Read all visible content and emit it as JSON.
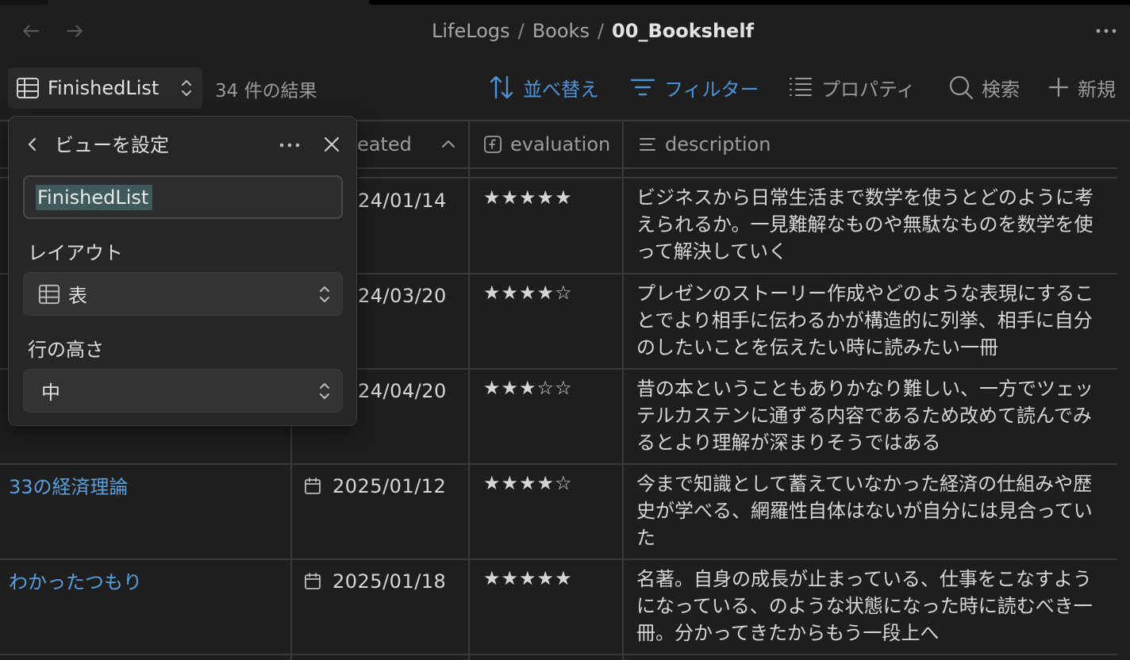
{
  "titlebar": {
    "breadcrumb": [
      "LifeLogs",
      "Books",
      "00_Bookshelf"
    ],
    "separator": "/",
    "back_icon": "arrow-left-icon",
    "forward_icon": "arrow-right-icon",
    "more_icon": "ellipsis-icon"
  },
  "toolbar": {
    "view_name": "FinishedList",
    "result_count": "34 件の結果",
    "sort_label": "並べ替え",
    "filter_label": "フィルター",
    "properties_label": "プロパティ",
    "search_label": "検索",
    "new_label": "新規",
    "accent_color": "#4e93d6"
  },
  "table": {
    "columns": [
      {
        "label": "created",
        "visible_text": "eated",
        "icon": "calendar-icon"
      },
      {
        "label": "evaluation",
        "icon": "formula-icon"
      },
      {
        "label": "description",
        "icon": "text-lines-icon"
      }
    ],
    "rows": [
      {
        "title": "",
        "date": "24/01/14",
        "evaluation": "★★★★★",
        "description": "ビジネスから日常生活まで数学を使うとどのように考えられるか。一見難解なものや無駄なものを数学を使って解決していく"
      },
      {
        "title": "",
        "date": "24/03/20",
        "evaluation": "★★★★☆",
        "description": "プレゼンのストーリー作成やどのような表現にすることでより相手に伝わるかが構造的に列挙、相手に自分のしたいことを伝えたい時に読みたい一冊"
      },
      {
        "title": "",
        "date": "24/04/20",
        "evaluation": "★★★☆☆",
        "description": "昔の本ということもありかなり難しい、一方でツェッテルカステンに通ずる内容であるため改めて読んでみるとより理解が深まりそうではある"
      },
      {
        "title": "33の経済理論",
        "date": "2025/01/12",
        "evaluation": "★★★★☆",
        "description": "今まで知識として蓄えていなかった経済の仕組みや歴史が学べる、網羅性自体はないが自分には見合っていた"
      },
      {
        "title": "わかったつもり",
        "date": "2025/01/18",
        "evaluation": "★★★★★",
        "description": "名著。自身の成長が止まっている、仕事をこなすようになっている、のような状態になった時に読むべき一冊。分かってきたからもう一段上へ"
      }
    ]
  },
  "popup": {
    "title": "ビューを設定",
    "view_name_value": "FinishedList",
    "layout_label": "レイアウト",
    "layout_value": "表",
    "row_height_label": "行の高さ",
    "row_height_value": "中"
  }
}
